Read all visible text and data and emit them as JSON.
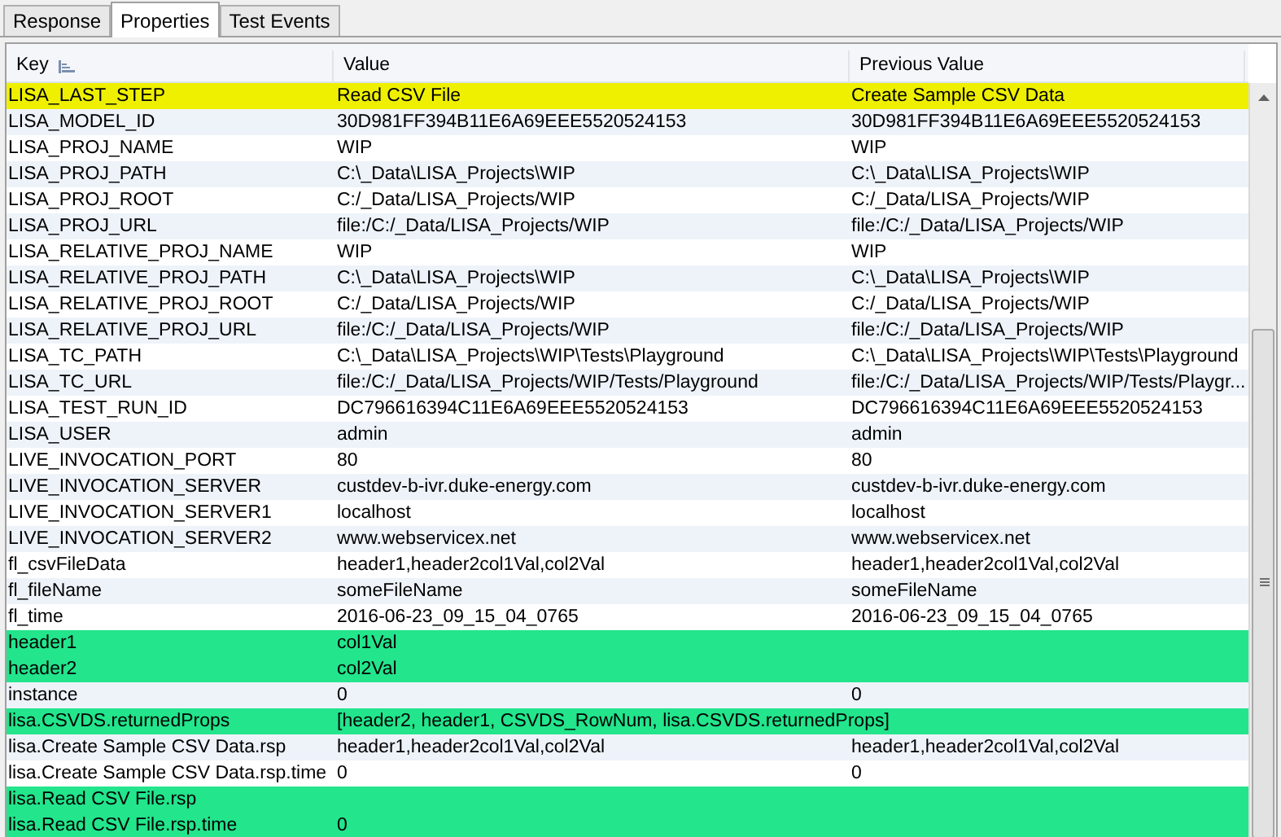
{
  "tabs": [
    {
      "label": "Response",
      "selected": false
    },
    {
      "label": "Properties",
      "selected": true
    },
    {
      "label": "Test Events",
      "selected": false
    }
  ],
  "table": {
    "columns": [
      "Key",
      "Value",
      "Previous Value"
    ],
    "rows": [
      {
        "key": "LISA_LAST_STEP",
        "value": "Read CSV File",
        "previous": "Create Sample CSV Data",
        "changed": true,
        "added": false
      },
      {
        "key": "LISA_MODEL_ID",
        "value": "30D981FF394B11E6A69EEE5520524153",
        "previous": "30D981FF394B11E6A69EEE5520524153",
        "changed": false,
        "added": false
      },
      {
        "key": "LISA_PROJ_NAME",
        "value": "WIP",
        "previous": "WIP",
        "changed": false,
        "added": false
      },
      {
        "key": "LISA_PROJ_PATH",
        "value": "C:\\_Data\\LISA_Projects\\WIP",
        "previous": "C:\\_Data\\LISA_Projects\\WIP",
        "changed": false,
        "added": false
      },
      {
        "key": "LISA_PROJ_ROOT",
        "value": "C:/_Data/LISA_Projects/WIP",
        "previous": "C:/_Data/LISA_Projects/WIP",
        "changed": false,
        "added": false
      },
      {
        "key": "LISA_PROJ_URL",
        "value": "file:/C:/_Data/LISA_Projects/WIP",
        "previous": "file:/C:/_Data/LISA_Projects/WIP",
        "changed": false,
        "added": false
      },
      {
        "key": "LISA_RELATIVE_PROJ_NAME",
        "value": "WIP",
        "previous": "WIP",
        "changed": false,
        "added": false
      },
      {
        "key": "LISA_RELATIVE_PROJ_PATH",
        "value": "C:\\_Data\\LISA_Projects\\WIP",
        "previous": "C:\\_Data\\LISA_Projects\\WIP",
        "changed": false,
        "added": false
      },
      {
        "key": "LISA_RELATIVE_PROJ_ROOT",
        "value": "C:/_Data/LISA_Projects/WIP",
        "previous": "C:/_Data/LISA_Projects/WIP",
        "changed": false,
        "added": false
      },
      {
        "key": "LISA_RELATIVE_PROJ_URL",
        "value": "file:/C:/_Data/LISA_Projects/WIP",
        "previous": "file:/C:/_Data/LISA_Projects/WIP",
        "changed": false,
        "added": false
      },
      {
        "key": "LISA_TC_PATH",
        "value": "C:\\_Data\\LISA_Projects\\WIP\\Tests\\Playground",
        "previous": "C:\\_Data\\LISA_Projects\\WIP\\Tests\\Playground",
        "changed": false,
        "added": false
      },
      {
        "key": "LISA_TC_URL",
        "value": "file:/C:/_Data/LISA_Projects/WIP/Tests/Playground",
        "previous": "file:/C:/_Data/LISA_Projects/WIP/Tests/Playgr...",
        "changed": false,
        "added": false
      },
      {
        "key": "LISA_TEST_RUN_ID",
        "value": "DC796616394C11E6A69EEE5520524153",
        "previous": "DC796616394C11E6A69EEE5520524153",
        "changed": false,
        "added": false
      },
      {
        "key": "LISA_USER",
        "value": "admin",
        "previous": "admin",
        "changed": false,
        "added": false
      },
      {
        "key": "LIVE_INVOCATION_PORT",
        "value": "80",
        "previous": "80",
        "changed": false,
        "added": false
      },
      {
        "key": "LIVE_INVOCATION_SERVER",
        "value": "custdev-b-ivr.duke-energy.com",
        "previous": "custdev-b-ivr.duke-energy.com",
        "changed": false,
        "added": false
      },
      {
        "key": "LIVE_INVOCATION_SERVER1",
        "value": "localhost",
        "previous": "localhost",
        "changed": false,
        "added": false
      },
      {
        "key": "LIVE_INVOCATION_SERVER2",
        "value": "www.webservicex.net",
        "previous": "www.webservicex.net",
        "changed": false,
        "added": false
      },
      {
        "key": "fl_csvFileData",
        "value": "header1,header2col1Val,col2Val",
        "previous": "header1,header2col1Val,col2Val",
        "changed": false,
        "added": false
      },
      {
        "key": "fl_fileName",
        "value": "someFileName",
        "previous": "someFileName",
        "changed": false,
        "added": false
      },
      {
        "key": "fl_time",
        "value": "2016-06-23_09_15_04_0765",
        "previous": "2016-06-23_09_15_04_0765",
        "changed": false,
        "added": false
      },
      {
        "key": "header1",
        "value": "col1Val",
        "changed": false,
        "added": true
      },
      {
        "key": "header2",
        "value": "col2Val",
        "changed": false,
        "added": true
      },
      {
        "key": "instance",
        "value": "0",
        "previous": "0",
        "changed": false,
        "added": false
      },
      {
        "key": "lisa.CSVDS.returnedProps",
        "value": "[header2, header1, CSVDS_RowNum, lisa.CSVDS.returnedProps]",
        "changed": false,
        "added": true
      },
      {
        "key": "lisa.Create Sample CSV Data.rsp",
        "value": "header1,header2col1Val,col2Val",
        "previous": "header1,header2col1Val,col2Val",
        "changed": false,
        "added": false
      },
      {
        "key": "lisa.Create Sample CSV Data.rsp.time",
        "value": "0",
        "previous": "0",
        "changed": false,
        "added": false
      },
      {
        "key": "lisa.Read CSV File.rsp",
        "changed": false,
        "added": true
      },
      {
        "key": "lisa.Read CSV File.rsp.time",
        "value": "0",
        "changed": false,
        "added": true
      }
    ]
  }
}
